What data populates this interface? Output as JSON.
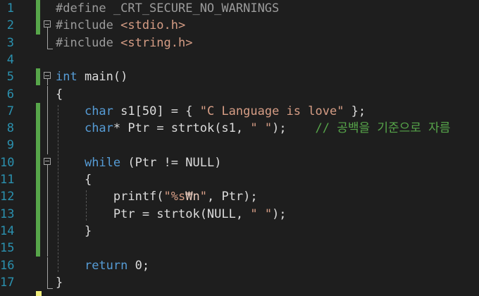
{
  "editor": {
    "colors": {
      "background": "#1e1e1e",
      "line_number": "#2b91af",
      "keyword": "#569cd6",
      "string": "#d69d85",
      "comment": "#57a64a",
      "preprocessor": "#9b9b9b",
      "change_saved": "#57a64a"
    },
    "lines": [
      {
        "num": "1",
        "changed": true,
        "fold": "",
        "tokens": [
          {
            "t": "#define _CRT_SECURE_NO_WARNINGS",
            "c": "pp"
          }
        ]
      },
      {
        "num": "2",
        "changed": true,
        "fold": "open",
        "tokens": [
          {
            "t": "#include ",
            "c": "pp"
          },
          {
            "t": "<stdio.h>",
            "c": "str"
          }
        ]
      },
      {
        "num": "3",
        "changed": false,
        "fold": "end",
        "tokens": [
          {
            "t": "#include ",
            "c": "pp"
          },
          {
            "t": "<string.h>",
            "c": "str"
          }
        ]
      },
      {
        "num": "4",
        "changed": false,
        "fold": "",
        "tokens": []
      },
      {
        "num": "5",
        "changed": true,
        "fold": "open",
        "tokens": [
          {
            "t": "int",
            "c": "kw"
          },
          {
            "t": " main()",
            "c": "pl"
          }
        ]
      },
      {
        "num": "6",
        "changed": false,
        "fold": "bar",
        "tokens": [
          {
            "t": "{",
            "c": "pl"
          }
        ]
      },
      {
        "num": "7",
        "changed": true,
        "fold": "bar",
        "tokens": [
          {
            "t": "    ",
            "c": "pl"
          },
          {
            "t": "char",
            "c": "kw"
          },
          {
            "t": " s1[50] = { ",
            "c": "pl"
          },
          {
            "t": "\"C Language is love\"",
            "c": "str"
          },
          {
            "t": " };",
            "c": "pl"
          }
        ]
      },
      {
        "num": "8",
        "changed": true,
        "fold": "bar",
        "tokens": [
          {
            "t": "    ",
            "c": "pl"
          },
          {
            "t": "char",
            "c": "kw"
          },
          {
            "t": "* Ptr = strtok(s1, ",
            "c": "pl"
          },
          {
            "t": "\" \"",
            "c": "str"
          },
          {
            "t": ");    ",
            "c": "pl"
          },
          {
            "t": "// 공백을 기준으로 자름",
            "c": "cm"
          }
        ]
      },
      {
        "num": "9",
        "changed": true,
        "fold": "bar",
        "tokens": []
      },
      {
        "num": "10",
        "changed": true,
        "fold": "open",
        "tokens": [
          {
            "t": "    ",
            "c": "pl"
          },
          {
            "t": "while",
            "c": "kw"
          },
          {
            "t": " (Ptr != NULL)",
            "c": "pl"
          }
        ]
      },
      {
        "num": "11",
        "changed": true,
        "fold": "bar",
        "tokens": [
          {
            "t": "    {",
            "c": "pl"
          }
        ]
      },
      {
        "num": "12",
        "changed": true,
        "fold": "bar",
        "tokens": [
          {
            "t": "        printf(",
            "c": "pl"
          },
          {
            "t": "\"%s",
            "c": "str"
          },
          {
            "t": "₩n",
            "c": "esc"
          },
          {
            "t": "\"",
            "c": "str"
          },
          {
            "t": ", Ptr);",
            "c": "pl"
          }
        ]
      },
      {
        "num": "13",
        "changed": true,
        "fold": "bar",
        "tokens": [
          {
            "t": "        Ptr = strtok(NULL, ",
            "c": "pl"
          },
          {
            "t": "\" \"",
            "c": "str"
          },
          {
            "t": ");",
            "c": "pl"
          }
        ]
      },
      {
        "num": "14",
        "changed": true,
        "fold": "bar",
        "tokens": [
          {
            "t": "    }",
            "c": "pl"
          }
        ]
      },
      {
        "num": "15",
        "changed": true,
        "fold": "bar",
        "tokens": []
      },
      {
        "num": "16",
        "changed": false,
        "fold": "bar",
        "tokens": [
          {
            "t": "    ",
            "c": "pl"
          },
          {
            "t": "return",
            "c": "kw"
          },
          {
            "t": " 0;",
            "c": "pl"
          }
        ]
      },
      {
        "num": "17",
        "changed": false,
        "fold": "end",
        "tokens": [
          {
            "t": "}",
            "c": "pl"
          }
        ]
      }
    ]
  }
}
